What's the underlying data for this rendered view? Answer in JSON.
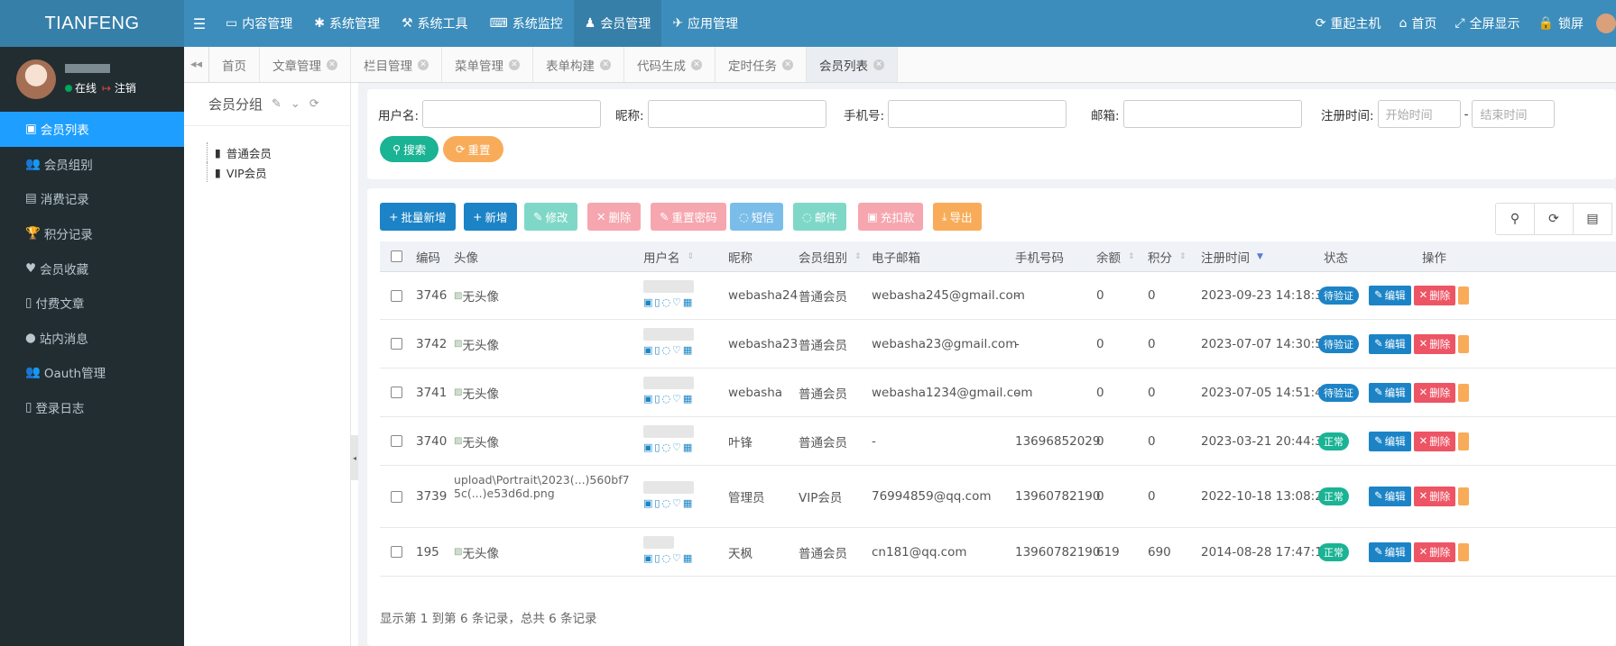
{
  "brand": "TIANFENG",
  "nav": {
    "items": [
      {
        "icon": "monitor-icon",
        "label": "内容管理"
      },
      {
        "icon": "gear-icon",
        "label": "系统管理"
      },
      {
        "icon": "wrench-icon",
        "label": "系统工具"
      },
      {
        "icon": "keyboard-icon",
        "label": "系统监控"
      },
      {
        "icon": "user-icon",
        "label": "会员管理"
      },
      {
        "icon": "rocket-icon",
        "label": "应用管理"
      }
    ],
    "right": [
      {
        "icon": "refresh-icon",
        "label": "重起主机"
      },
      {
        "icon": "home-icon",
        "label": "首页"
      },
      {
        "icon": "fullscreen-icon",
        "label": "全屏显示"
      },
      {
        "icon": "lock-icon",
        "label": "锁屏"
      }
    ]
  },
  "user": {
    "status": "在线",
    "logout": "注销"
  },
  "sidebar": {
    "items": [
      {
        "label": "会员列表",
        "icon": "card-icon"
      },
      {
        "label": "会员组别",
        "icon": "users-icon"
      },
      {
        "label": "消费记录",
        "icon": "money-icon"
      },
      {
        "label": "积分记录",
        "icon": "trophy-icon"
      },
      {
        "label": "会员收藏",
        "icon": "heart-icon"
      },
      {
        "label": "付费文章",
        "icon": "file-icon"
      },
      {
        "label": "站内消息",
        "icon": "chat-icon"
      },
      {
        "label": "Oauth管理",
        "icon": "users-icon"
      },
      {
        "label": "登录日志",
        "icon": "book-icon"
      }
    ]
  },
  "tabs": [
    "首页",
    "文章管理",
    "栏目管理",
    "菜单管理",
    "表单构建",
    "代码生成",
    "定时任务",
    "会员列表"
  ],
  "group_panel": {
    "title": "会员分组",
    "nodes": [
      "普通会员",
      "VIP会员"
    ]
  },
  "search": {
    "username_label": "用户名:",
    "nickname_label": "昵称:",
    "phone_label": "手机号:",
    "email_label": "邮箱:",
    "regtime_label": "注册时间:",
    "start_placeholder": "开始时间",
    "dash": "-",
    "end_placeholder": "结束时间",
    "search_btn": "搜索",
    "reset_btn": "重置"
  },
  "toolbar": {
    "batch_add": "批量新增",
    "add": "新增",
    "edit": "修改",
    "delete": "删除",
    "reset_pwd": "重置密码",
    "sms": "短信",
    "mail": "邮件",
    "recharge": "充扣款",
    "export": "导出"
  },
  "colors": {
    "primary": "#1c84c6",
    "header": "#3c8dbc",
    "sidebar": "#222d32",
    "active": "#1e9fff",
    "danger": "#ed5565",
    "warning": "#f8ac59",
    "success": "#1ab394"
  },
  "table": {
    "headers": {
      "id": "编码",
      "avatar": "头像",
      "username": "用户名",
      "nickname": "昵称",
      "group": "会员组别",
      "email": "电子邮箱",
      "phone": "手机号码",
      "balance": "余额",
      "points": "积分",
      "regtime": "注册时间",
      "status": "状态",
      "actions": "操作"
    },
    "rows": [
      {
        "id": "3746",
        "avatar": "无头像",
        "nickname": "webasha24",
        "group": "普通会员",
        "email": "webasha245@gmail.com",
        "phone": "-",
        "balance": "0",
        "points": "0",
        "regtime": "2023-09-23 14:18:30",
        "status": "待验证",
        "edit": "编辑",
        "del": "删除"
      },
      {
        "id": "3742",
        "avatar": "无头像",
        "nickname": "webasha23",
        "group": "普通会员",
        "email": "webasha23@gmail.com",
        "phone": "-",
        "balance": "0",
        "points": "0",
        "regtime": "2023-07-07 14:30:56",
        "status": "待验证",
        "edit": "编辑",
        "del": "删除"
      },
      {
        "id": "3741",
        "avatar": "无头像",
        "nickname": "webasha",
        "group": "普通会员",
        "email": "webasha1234@gmail.com",
        "phone": "-",
        "balance": "0",
        "points": "0",
        "regtime": "2023-07-05 14:51:44",
        "status": "待验证",
        "edit": "编辑",
        "del": "删除"
      },
      {
        "id": "3740",
        "avatar": "无头像",
        "nickname": "叶锋",
        "group": "普通会员",
        "email": "-",
        "phone": "13696852029",
        "balance": "0",
        "points": "0",
        "regtime": "2023-03-21 20:44:31",
        "status": "正常",
        "edit": "编辑",
        "del": "删除"
      },
      {
        "id": "3739",
        "avatar": "upload\\Portrait\\2023(...)560bf75c(...)e53d6d.png",
        "nickname": "管理员",
        "group": "VIP会员",
        "email": "76994859@qq.com",
        "phone": "13960782190",
        "balance": "0",
        "points": "0",
        "regtime": "2022-10-18 13:08:27",
        "status": "正常",
        "edit": "编辑",
        "del": "删除"
      },
      {
        "id": "195",
        "avatar": "无头像",
        "nickname": "天枫",
        "group": "普通会员",
        "email": "cn181@qq.com",
        "phone": "13960782190",
        "balance": "619",
        "points": "690",
        "regtime": "2014-08-28 17:47:13",
        "status": "正常",
        "edit": "编辑",
        "del": "删除"
      }
    ]
  },
  "pager_text": "显示第 1 到第 6 条记录，总共 6 条记录"
}
